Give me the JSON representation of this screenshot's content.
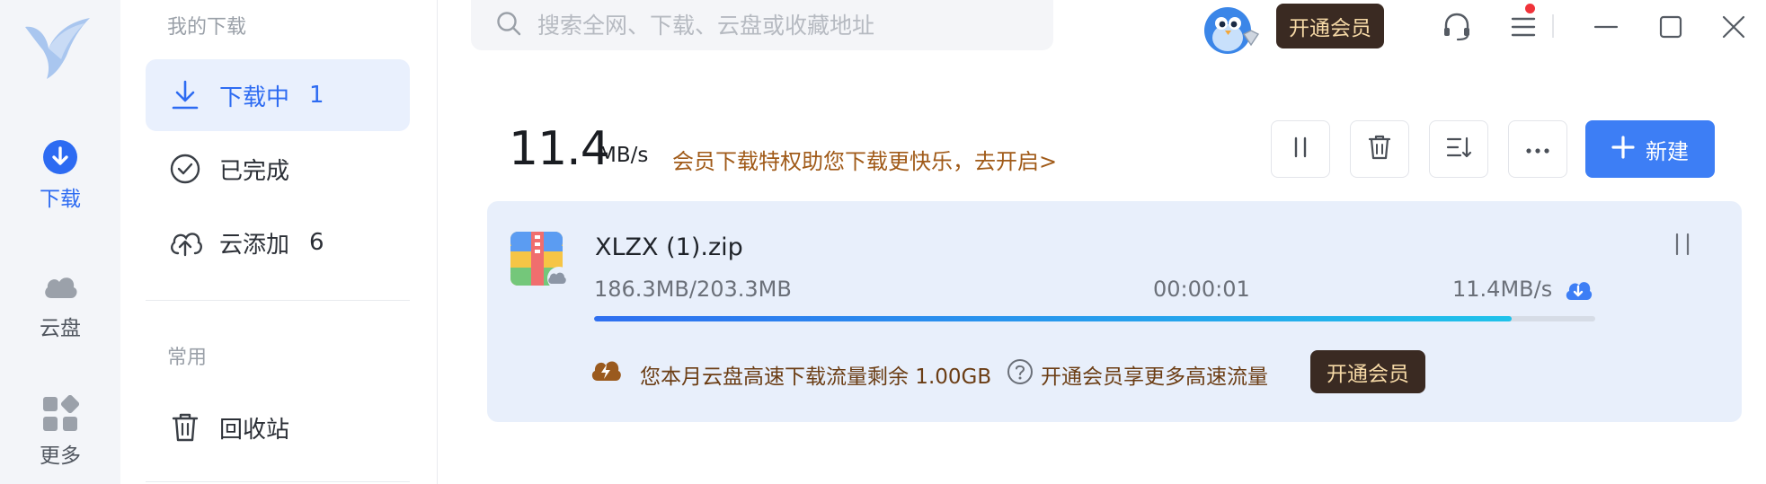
{
  "rail": {
    "items": [
      {
        "label": "下载",
        "icon": "download-icon",
        "active": true
      },
      {
        "label": "云盘",
        "icon": "cloud-icon",
        "active": false
      },
      {
        "label": "更多",
        "icon": "apps-icon",
        "active": false
      }
    ]
  },
  "sidebar": {
    "section_downloads": "我的下载",
    "items": [
      {
        "label": "下载中",
        "count": "1",
        "icon": "download-arrow-icon"
      },
      {
        "label": "已完成",
        "count": "",
        "icon": "check-circle-icon"
      },
      {
        "label": "云添加",
        "count": "6",
        "icon": "cloud-upload-icon"
      }
    ],
    "section_common": "常用",
    "recycle": {
      "label": "回收站",
      "icon": "trash-icon"
    }
  },
  "search": {
    "placeholder": "搜索全网、下载、云盘或收藏地址"
  },
  "topbar": {
    "vip_label": "开通会员"
  },
  "speed": {
    "value": "11.4",
    "unit": "MB/s",
    "promo": "会员下载特权助您下载更快乐，去开启>"
  },
  "toolbar": {
    "new_label": "新建"
  },
  "task": {
    "name": "XLZX (1).zip",
    "progress_text": "186.3MB/203.3MB",
    "time": "00:00:01",
    "rate": "11.4MB/s",
    "progress": 0.9164
  },
  "quota": {
    "text": "您本月云盘高速下载流量剩余 1.00GB",
    "more": "开通会员享更多高速流量",
    "vip_label": "开通会员"
  },
  "colors": {
    "accent": "#3d7ef5",
    "vip_bg": "#3a2a22",
    "vip_text": "#f6d9a6",
    "promo": "#a05a18"
  }
}
